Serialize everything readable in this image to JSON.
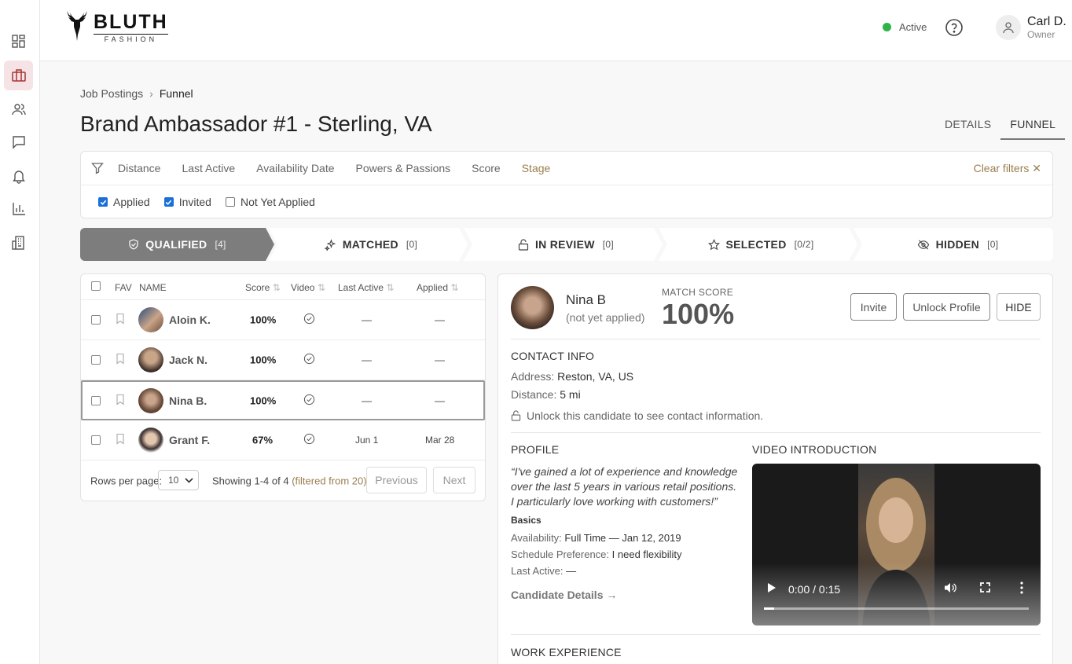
{
  "app": {
    "brand_name": "BLUTH",
    "brand_sub": "FASHION",
    "status": "Active",
    "user_name": "Carl D.",
    "user_role": "Owner"
  },
  "breadcrumb": {
    "parent": "Job Postings",
    "current": "Funnel"
  },
  "page": {
    "title": "Brand Ambassador #1 - Sterling, VA",
    "tabs": [
      {
        "label": "DETAILS"
      },
      {
        "label": "FUNNEL"
      }
    ]
  },
  "filters": {
    "items": [
      "Distance",
      "Last Active",
      "Availability Date",
      "Powers & Passions",
      "Score",
      "Stage"
    ],
    "active_item": "Stage",
    "clear_label": "Clear filters",
    "checks": [
      {
        "label": "Applied",
        "checked": true
      },
      {
        "label": "Invited",
        "checked": true
      },
      {
        "label": "Not Yet Applied",
        "checked": false
      }
    ]
  },
  "stages": [
    {
      "label": "QUALIFIED",
      "count": "[4]",
      "icon": "shield-check-icon"
    },
    {
      "label": "MATCHED",
      "count": "[0]",
      "icon": "sparkle-icon"
    },
    {
      "label": "IN REVIEW",
      "count": "[0]",
      "icon": "lock-icon"
    },
    {
      "label": "SELECTED",
      "count": "[0/2]",
      "icon": "star-icon"
    },
    {
      "label": "HIDDEN",
      "count": "[0]",
      "icon": "eye-off-icon"
    }
  ],
  "table": {
    "headers": {
      "fav": "FAV",
      "name": "NAME",
      "score": "Score",
      "video": "Video",
      "last_active": "Last Active",
      "applied": "Applied"
    },
    "rows": [
      {
        "name": "Aloin K.",
        "score": "100%",
        "last_active": "—",
        "applied": "—"
      },
      {
        "name": "Jack N.",
        "score": "100%",
        "last_active": "—",
        "applied": "—"
      },
      {
        "name": "Nina B.",
        "score": "100%",
        "last_active": "—",
        "applied": "—"
      },
      {
        "name": "Grant F.",
        "score": "67%",
        "last_active": "Jun 1",
        "applied": "Mar 28"
      }
    ],
    "footer": {
      "rows_label": "Rows per page:",
      "rows_value": "10",
      "showing": "Showing 1-4 of 4",
      "filtered": "(filtered from 20)",
      "prev": "Previous",
      "next": "Next"
    }
  },
  "detail": {
    "name": "Nina B",
    "sub": "(not yet applied)",
    "match_label": "MATCH SCORE",
    "match_score": "100%",
    "buttons": {
      "invite": "Invite",
      "unlock": "Unlock Profile",
      "hide": "HIDE"
    },
    "contact": {
      "heading": "CONTACT INFO",
      "address_label": "Address:",
      "address": "Reston, VA, US",
      "distance_label": "Distance:",
      "distance": "5 mi",
      "lock_note": "Unlock this candidate to see contact information."
    },
    "profile": {
      "heading": "PROFILE",
      "quote": "“I've gained a lot of experience and knowledge over the last 5 years in various retail positions. I particularly love working with customers!”",
      "basics": "Basics",
      "availability_label": "Availability:",
      "availability": "Full Time — Jan 12, 2019",
      "schedule_label": "Schedule Preference:",
      "schedule": "I need flexibility",
      "last_active_label": "Last Active:",
      "last_active": "—",
      "details_link": "Candidate Details →"
    },
    "video": {
      "heading": "VIDEO INTRODUCTION",
      "time": "0:00 / 0:15",
      "progress": 0.04
    },
    "work_heading": "WORK EXPERIENCE"
  },
  "colors": {
    "accent": "#9b7e4f",
    "stage_active": "#7d7d7d",
    "status_green": "#2fb34a",
    "sidebar_active": "#f6e3e5"
  }
}
